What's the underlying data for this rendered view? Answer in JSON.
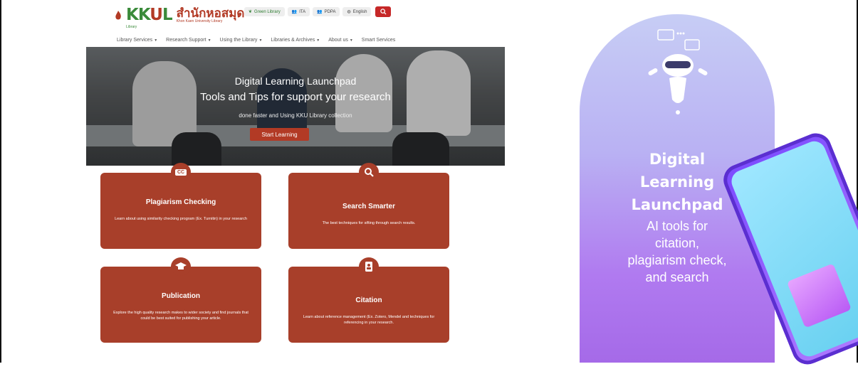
{
  "header": {
    "logo_mark_k1": "KK",
    "logo_mark_u": "U",
    "logo_mark_l": "L",
    "logo_thai": "สำนักหอสมุด",
    "logo_eng": "Khon Kaen University Library",
    "logo_sub": "Library"
  },
  "topbar": {
    "green_library": "Green Library",
    "ita": "ITA",
    "pdpa": "PDPA",
    "english": "English"
  },
  "nav": [
    {
      "label": "Library Services",
      "caret": "▼"
    },
    {
      "label": "Research Support",
      "caret": "▼"
    },
    {
      "label": "Using the Library",
      "caret": "▼"
    },
    {
      "label": "Libraries & Archives",
      "caret": "▼"
    },
    {
      "label": "About us",
      "caret": "▼"
    },
    {
      "label": "Smart Services",
      "caret": ""
    }
  ],
  "hero": {
    "title": "Digital Learning Launchpad",
    "subtitle": "Tools and Tips for support your research",
    "small": "done faster and Using KKU Library collection",
    "button": "Start Learning"
  },
  "cards": {
    "plagiarism": {
      "badge": "CC",
      "title": "Plagiarism Checking",
      "desc": "Learn about using similarity checking program (Ex. Turnitin) in your research"
    },
    "search": {
      "title": "Search Smarter",
      "desc": "The best techniques for sifting through search results."
    },
    "publication": {
      "title": "Publication",
      "desc": "Explore the high quality research makes to wider society and find journals that could be best suited for publishing your article."
    },
    "citation": {
      "title": "Citation",
      "desc": "Learn about reference management (Ex. Zotero, Mendel and techniques for referencing in your research."
    }
  },
  "promo": {
    "line1": "Digital",
    "line2": "Learning",
    "line3": "Launchpad",
    "text1": "AI tools for",
    "text2": "citation,",
    "text3": "plagiarism check,",
    "text4": "and search"
  },
  "colors": {
    "brand_red": "#a83f2a",
    "brand_green": "#3a8a3a",
    "promo_purple": "#b07af0"
  }
}
